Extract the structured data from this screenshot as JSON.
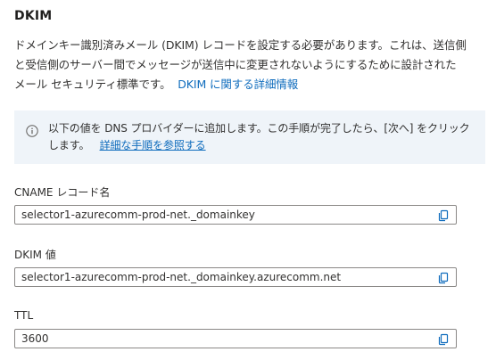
{
  "section": {
    "title": "DKIM",
    "description_line1": "ドメインキー識別済みメール (DKIM) レコードを設定する必要があります。これは、送信側",
    "description_line2": "と受信側のサーバー間でメッセージが送信中に変更されないようにするために設計された",
    "description_line3": "メール セキュリティ標準です。",
    "description_link": "DKIM に関する詳細情報"
  },
  "info_banner": {
    "icon": "info-icon",
    "text_line1": "以下の値を DNS プロバイダーに追加します。この手順が完了したら、[次へ] をクリック",
    "text_line2": "します。",
    "link": "詳細な手順を参照する"
  },
  "fields": {
    "cname": {
      "label": "CNAME レコード名",
      "value": "selector1-azurecomm-prod-net._domainkey"
    },
    "dkim": {
      "label": "DKIM 値",
      "value": "selector1-azurecomm-prod-net._domainkey.azurecomm.net"
    },
    "ttl": {
      "label": "TTL",
      "value": "3600"
    }
  },
  "colors": {
    "link": "#0f6cbd",
    "banner_bg": "#eff4f9",
    "border": "#8a8886"
  }
}
